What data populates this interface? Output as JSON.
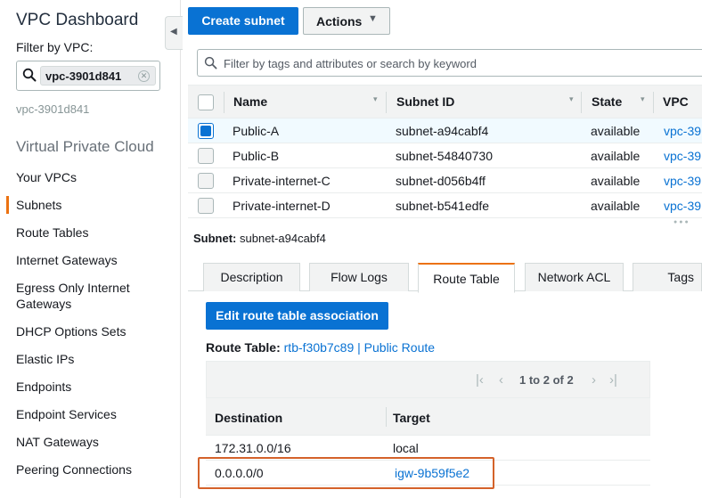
{
  "sidebar": {
    "title": "VPC Dashboard",
    "filter_label": "Filter by VPC:",
    "filter_value": "vpc-3901d841",
    "selected_vpc": "vpc-3901d841",
    "section_title": "Virtual Private Cloud",
    "items": [
      {
        "label": "Your VPCs"
      },
      {
        "label": "Subnets",
        "active": true
      },
      {
        "label": "Route Tables"
      },
      {
        "label": "Internet Gateways"
      },
      {
        "label": "Egress Only Internet Gateways"
      },
      {
        "label": "DHCP Options Sets"
      },
      {
        "label": "Elastic IPs"
      },
      {
        "label": "Endpoints"
      },
      {
        "label": "Endpoint Services"
      },
      {
        "label": "NAT Gateways"
      },
      {
        "label": "Peering Connections"
      }
    ]
  },
  "toolbar": {
    "create_label": "Create subnet",
    "actions_label": "Actions"
  },
  "search": {
    "placeholder": "Filter by tags and attributes or search by keyword"
  },
  "subnet_table": {
    "columns": [
      "Name",
      "Subnet ID",
      "State",
      "VPC"
    ],
    "rows": [
      {
        "name": "Public-A",
        "subnet_id": "subnet-a94cabf4",
        "state": "available",
        "vpc": "vpc-39",
        "selected": true
      },
      {
        "name": "Public-B",
        "subnet_id": "subnet-54840730",
        "state": "available",
        "vpc": "vpc-39",
        "selected": false
      },
      {
        "name": "Private-internet-C",
        "subnet_id": "subnet-d056b4ff",
        "state": "available",
        "vpc": "vpc-39",
        "selected": false
      },
      {
        "name": "Private-internet-D",
        "subnet_id": "subnet-b541edfe",
        "state": "available",
        "vpc": "vpc-39",
        "selected": false
      }
    ]
  },
  "details": {
    "subnet_label": "Subnet:",
    "subnet_value": "subnet-a94cabf4",
    "tabs": [
      {
        "label": "Description"
      },
      {
        "label": "Flow Logs"
      },
      {
        "label": "Route Table",
        "active": true
      },
      {
        "label": "Network ACL"
      },
      {
        "label": "Tags"
      }
    ],
    "edit_button": "Edit route table association",
    "route_table_label": "Route Table:",
    "route_table_value": "rtb-f30b7c89 | Public Route"
  },
  "routes": {
    "pager_text": "1 to 2 of 2",
    "columns": [
      "Destination",
      "Target"
    ],
    "rows": [
      {
        "destination": "172.31.0.0/16",
        "target": "local",
        "target_link": false
      },
      {
        "destination": "0.0.0.0/0",
        "target": "igw-9b59f5e2",
        "target_link": true,
        "highlighted": true
      }
    ]
  },
  "colors": {
    "primary": "#0972d3",
    "accent": "#ec7211",
    "highlight_border": "#d4622a"
  }
}
